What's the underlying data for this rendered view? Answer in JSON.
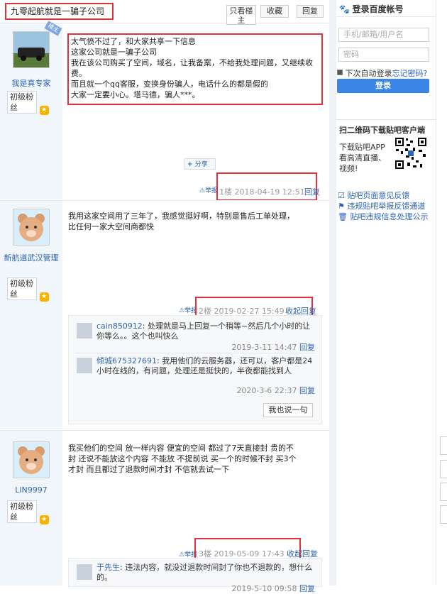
{
  "thread": {
    "title": "九零起航就是一骗子公司",
    "btn_only_op": "只看楼主",
    "btn_fav": "收藏",
    "btn_reply": "回复"
  },
  "login": {
    "title": "登录百度帐号",
    "username_placeholder": "手机/邮箱/用户名",
    "password_placeholder": "密码",
    "remember": "下次自动登录",
    "forgot": "忘记密码?",
    "submit": "登录"
  },
  "app": {
    "title": "扫二维码下载贴吧客户端",
    "desc": "下载贴吧APP 看高清直播、视频!"
  },
  "side_links": [
    "贴吧页面意见反馈",
    "违规贴吧举报反馈通道",
    "贴吧违规信息处理公示"
  ],
  "posts": [
    {
      "user": "我是真专家",
      "rank": "初级粉丝",
      "badge": "楼主",
      "lines": [
        "太气愤不过了，和大家共享一下信息",
        "这家公司就是一骗子公司",
        "我在该公司购买了空间，域名，让我备案，不给我处理问题，又继续收费。",
        "而且就一个qq客服，变换身份骗人，电话什么的都是假的",
        "大家一定要小心。塔马德，骗人***。"
      ],
      "share": "分享",
      "report": "举报",
      "floor_time": "1楼 2018-04-19 12:51",
      "reply": "回复"
    },
    {
      "user": "新航道武汉管理",
      "rank": "初级粉丝",
      "lines": [
        "我用这家空间用了三年了，我感觉挺好啊，特别是售后工单处理，",
        "比任何一家大空间商都快"
      ],
      "report": "举报",
      "floor_time": "2楼 2019-02-27 15:49",
      "collapse": "收起回复",
      "replies": [
        {
          "user": "cain850912",
          "text": "处理就是马上回复一个稍等~然后几个小时的让你等么。。这个也叫快么",
          "time": "2019-3-11 14:47",
          "reply": "回复"
        },
        {
          "user": "倾城675327691",
          "text": "我用他们的云服务器，还可以，客户都是24小时在线的，有问题，处理还是挺快的，半夜都能找到人",
          "time": "2020-3-6 22:37",
          "reply": "回复"
        }
      ],
      "say": "我也说一句"
    },
    {
      "user": "LIN9997",
      "rank": "初级粉丝",
      "lines": [
        "我买他们的空间 放一样内容 便宜的空间 都过了7天直接封 贵的不",
        "封 还说不能放这个内容 不能放 不提前说 买一个的时候不封 买3个",
        "才封 而且都过了退款时间才封 不信就去试一下"
      ],
      "report": "举报",
      "floor_time": "3楼 2019-05-09 17:43",
      "collapse": "收起回复",
      "replies": [
        {
          "user": "于先生",
          "text": "违法内容，就没过退款时间封了你也不退款的，想什么的。",
          "time": "2019-5-10 09:58",
          "reply": "回复"
        }
      ]
    }
  ]
}
